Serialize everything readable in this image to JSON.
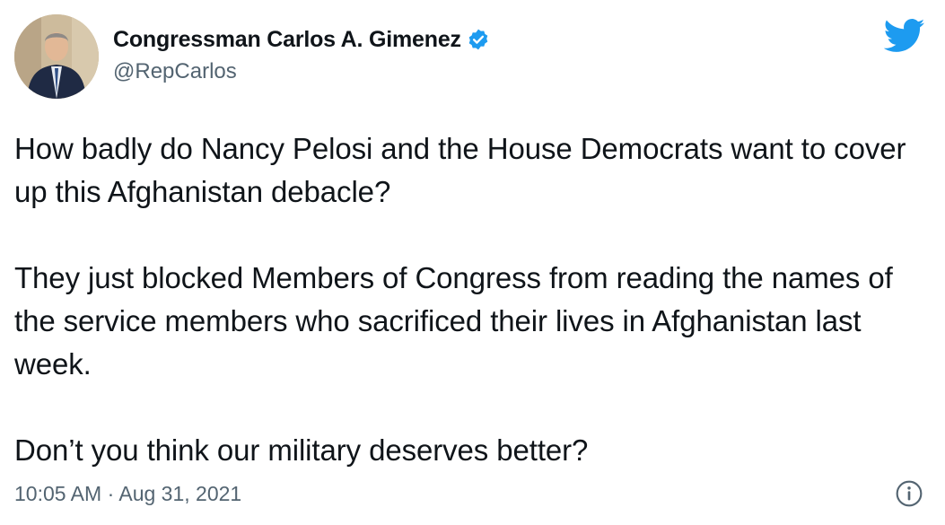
{
  "author": {
    "display_name": "Congressman Carlos A. Gimenez",
    "handle": "@RepCarlos",
    "avatar_icon": "profile-photo",
    "verified_icon": "verified-badge-icon"
  },
  "brand": {
    "icon": "twitter-bird-icon",
    "color": "#1d9bf0"
  },
  "tweet": {
    "paragraphs": [
      "How badly do Nancy Pelosi and the House Democrats want to cover up this Afghanistan debacle?",
      "They just blocked Members of Congress from reading the names of the service members who sacrificed their lives in Afghanistan last week.",
      "Don’t you think our military deserves better?"
    ],
    "timestamp": "10:05 AM · Aug 31, 2021"
  },
  "actions": {
    "info_icon": "info-icon"
  },
  "colors": {
    "text_primary": "#0f1419",
    "text_secondary": "#536471",
    "verified": "#1d9bf0"
  }
}
